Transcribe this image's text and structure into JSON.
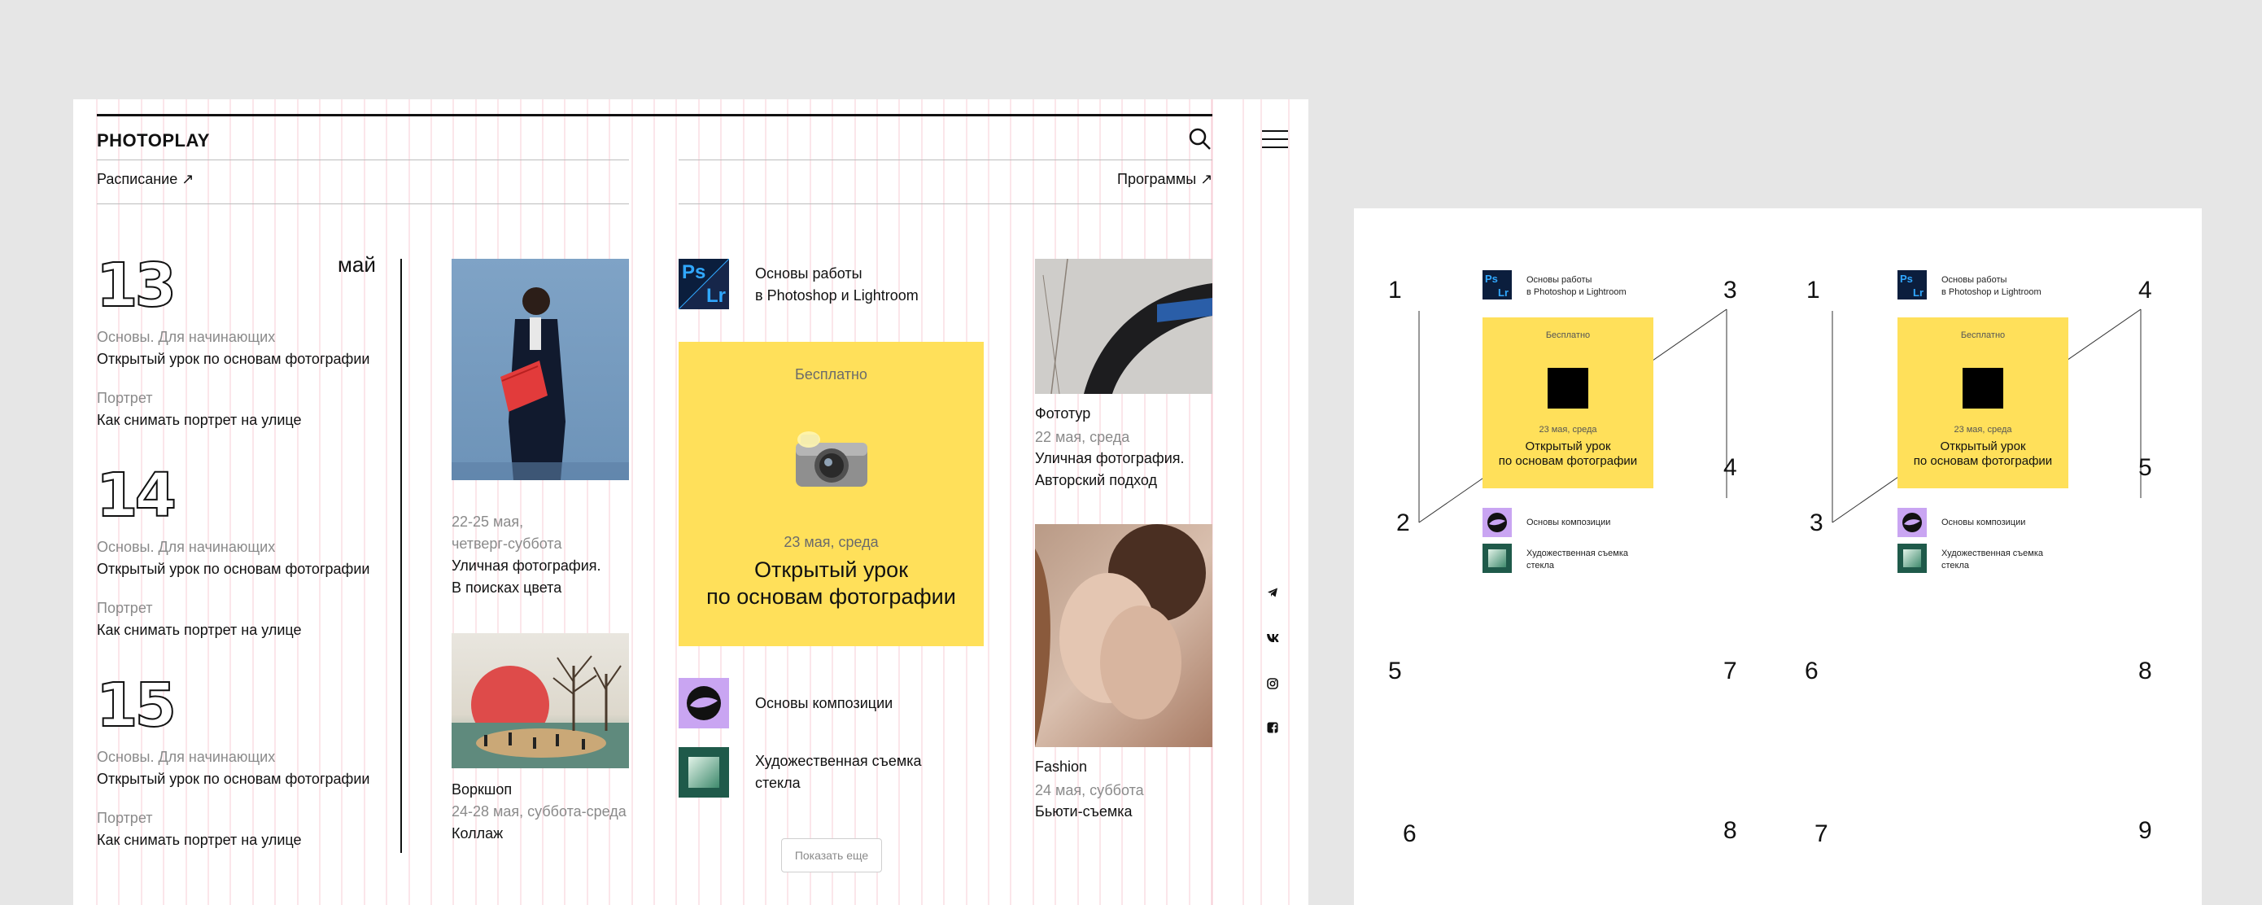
{
  "header": {
    "brand": "PHOTOPLAY",
    "schedule_link": "Расписание ↗",
    "programs_link": "Программы ↗"
  },
  "schedule": {
    "month": "май",
    "days": [
      {
        "number": "13",
        "items": [
          {
            "category": "Основы. Для начинающих",
            "title": "Открытый урок по основам фотографии"
          },
          {
            "category": "Портрет",
            "title": "Как снимать портрет на улице"
          }
        ]
      },
      {
        "number": "14",
        "items": [
          {
            "category": "Основы. Для начинающих",
            "title": "Открытый урок по основам фотографии"
          },
          {
            "category": "Портрет",
            "title": "Как снимать портрет на улице"
          }
        ]
      },
      {
        "number": "15",
        "items": [
          {
            "category": "Основы. Для начинающих",
            "title": "Открытый урок по основам фотографии"
          },
          {
            "category": "Портрет",
            "title": "Как снимать портрет на улице"
          }
        ]
      }
    ]
  },
  "events_left": [
    {
      "date_line1": "22-25 мая,",
      "date_line2": "четверг-суббота",
      "desc_line1": "Уличная фотография.",
      "desc_line2": "В поисках цвета"
    },
    {
      "type": "Воркшоп",
      "date": "24-28 мая, суббота-среда",
      "desc": "Коллаж"
    }
  ],
  "programs": {
    "item_top": {
      "line1": "Основы работы",
      "line2": "в Photoshop и Lightroom",
      "icon_ps": "Ps",
      "icon_lr": "Lr"
    },
    "promo": {
      "badge": "Бесплатно",
      "date": "23 мая, среда",
      "title_line1": "Открытый урок",
      "title_line2": "по основам фотографии"
    },
    "items": [
      {
        "line1": "Основы композиции"
      },
      {
        "line1": "Художественная съемка",
        "line2": "стекла"
      }
    ],
    "show_more": "Показать еще"
  },
  "events_right": [
    {
      "type": "Фототур",
      "date": "22 мая, среда",
      "desc_line1": "Уличная фотография.",
      "desc_line2": "Авторский подход"
    },
    {
      "type": "Fashion",
      "date": "24 мая, суббота",
      "desc": "Бьюти-съемка"
    }
  ],
  "sketch": {
    "left": {
      "item_top_line1": "Основы работы",
      "item_top_line2": "в Photoshop и Lightroom",
      "badge": "Бесплатно",
      "date": "23 мая, среда",
      "title_line1": "Открытый урок",
      "title_line2": "по основам фотографии",
      "item1": "Основы композиции",
      "item2_line1": "Художественная съемка",
      "item2_line2": "стекла",
      "numbers": [
        "1",
        "3",
        "2",
        "4",
        "5",
        "7",
        "6",
        "8"
      ]
    },
    "right": {
      "item_top_line1": "Основы работы",
      "item_top_line2": "в Photoshop и Lightroom",
      "badge": "Бесплатно",
      "date": "23 мая, среда",
      "title_line1": "Открытый урок",
      "title_line2": "по основам фотографии",
      "item1": "Основы композиции",
      "item2_line1": "Художественная съемка",
      "item2_line2": "стекла",
      "numbers": [
        "1",
        "4",
        "3",
        "5",
        "6",
        "8",
        "7",
        "9"
      ]
    }
  },
  "colors": {
    "promo_yellow": "#ffe05a",
    "grid_pink": "#f4b9c4",
    "composition_purple": "#c9a5f2",
    "glass_green": "#1f5a4a",
    "ps_blue": "#0b1e3d"
  }
}
